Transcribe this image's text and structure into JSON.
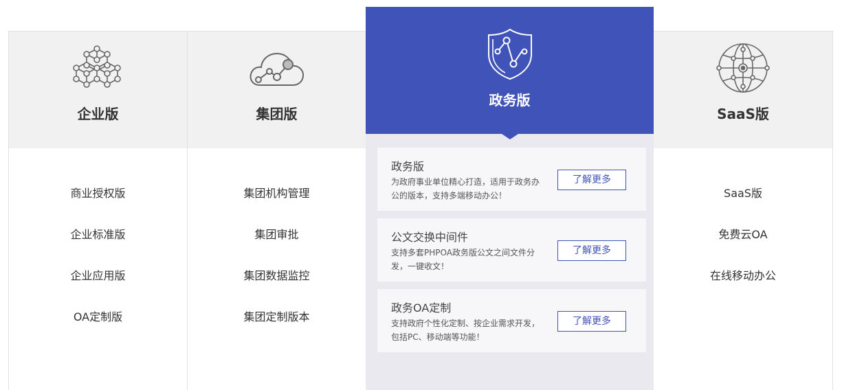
{
  "columns": [
    {
      "icon": "cube-network-icon",
      "title": "企业版",
      "items": [
        "商业授权版",
        "企业标准版",
        "企业应用版",
        "OA定制版"
      ]
    },
    {
      "icon": "cloud-network-icon",
      "title": "集团版",
      "items": [
        "集团机构管理",
        "集团审批",
        "集团数据监控",
        "集团定制版本"
      ]
    },
    {
      "icon": "globe-icon",
      "title": "SaaS版",
      "items": [
        "SaaS版",
        "免费云OA",
        "在线移动办公"
      ]
    }
  ],
  "featured": {
    "icon": "shield-icon",
    "title": "政务版",
    "cards": [
      {
        "title": "政务版",
        "desc": "为政府事业单位精心打造，适用于政务办公的版本，支持多端移动办公！",
        "button": "了解更多"
      },
      {
        "title": "公文交换中间件",
        "desc": "支持多套PHPOA政务版公文之间文件分发，一键收文！",
        "button": "了解更多"
      },
      {
        "title": "政务OA定制",
        "desc": "支持政府个性化定制、按企业需求开发，包括PC、移动端等功能！",
        "button": "了解更多"
      }
    ]
  },
  "colors": {
    "accent": "#4053b8",
    "header_bg": "#f1f1f1",
    "featured_bg": "#e9e9ef"
  }
}
